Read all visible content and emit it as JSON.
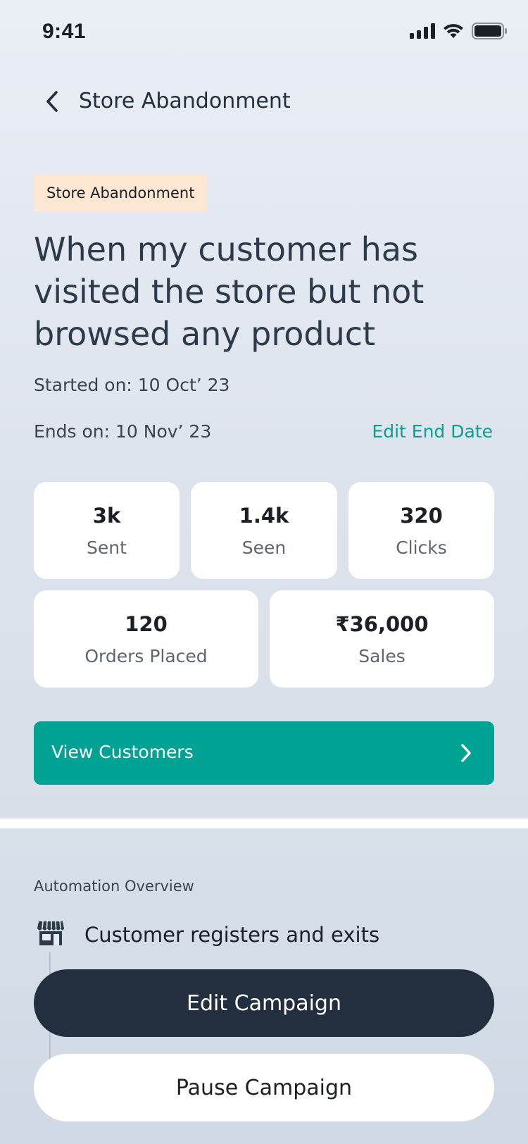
{
  "status_bar": {
    "time": "9:41",
    "icons": [
      "signal-icon",
      "wifi-icon",
      "battery-icon"
    ]
  },
  "header": {
    "back_icon": "chevron-left-icon",
    "title": "Store Abandonment"
  },
  "campaign": {
    "tag": "Store Abandonment",
    "headline": "When my customer has visited the store but not browsed any product",
    "started": "Started on: 10 Oct’ 23",
    "ends": "Ends on: 10 Nov’ 23",
    "edit_end_date": "Edit End Date"
  },
  "stats": [
    {
      "value": "3k",
      "label": "Sent"
    },
    {
      "value": "1.4k",
      "label": "Seen"
    },
    {
      "value": "320",
      "label": "Clicks"
    },
    {
      "value": "120",
      "label": "Orders Placed"
    },
    {
      "value": "₹36,000",
      "label": "Sales"
    }
  ],
  "view_customers": {
    "label": "View Customers",
    "icon": "chevron-right-icon"
  },
  "automation": {
    "title": "Automation Overview",
    "step_icon": "store-icon",
    "step_text": "Customer registers and exits"
  },
  "actions": {
    "edit": "Edit Campaign",
    "pause": "Pause Campaign"
  },
  "colors": {
    "accent": "#00a294",
    "dark": "#232f3e",
    "tag_bg": "#fde6d2"
  }
}
